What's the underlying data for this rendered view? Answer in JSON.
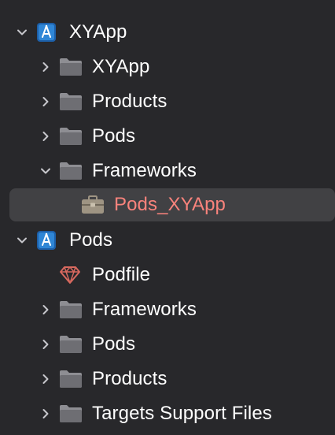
{
  "tree": {
    "items": [
      {
        "label": "XYApp",
        "icon": "xcode-project-icon",
        "expanded": true
      },
      {
        "label": "XYApp",
        "icon": "folder-icon",
        "expanded": false
      },
      {
        "label": "Products",
        "icon": "folder-icon",
        "expanded": false
      },
      {
        "label": "Pods",
        "icon": "folder-icon",
        "expanded": false
      },
      {
        "label": "Frameworks",
        "icon": "folder-icon",
        "expanded": true
      },
      {
        "label": "Pods_XYApp",
        "icon": "toolbox-icon",
        "selected": true,
        "color": "#f9837c"
      },
      {
        "label": "Pods",
        "icon": "xcode-project-icon",
        "expanded": true
      },
      {
        "label": "Podfile",
        "icon": "ruby-gem-icon"
      },
      {
        "label": "Frameworks",
        "icon": "folder-icon",
        "expanded": false
      },
      {
        "label": "Pods",
        "icon": "folder-icon",
        "expanded": false
      },
      {
        "label": "Products",
        "icon": "folder-icon",
        "expanded": false
      },
      {
        "label": "Targets Support Files",
        "icon": "folder-icon",
        "expanded": false
      }
    ]
  },
  "colors": {
    "background": "#28282b",
    "selection": "#414144",
    "selected_text": "#f9837c",
    "folder": "#8e8e93",
    "project_icon": "#2f86d6",
    "gem": "#d8695f"
  }
}
